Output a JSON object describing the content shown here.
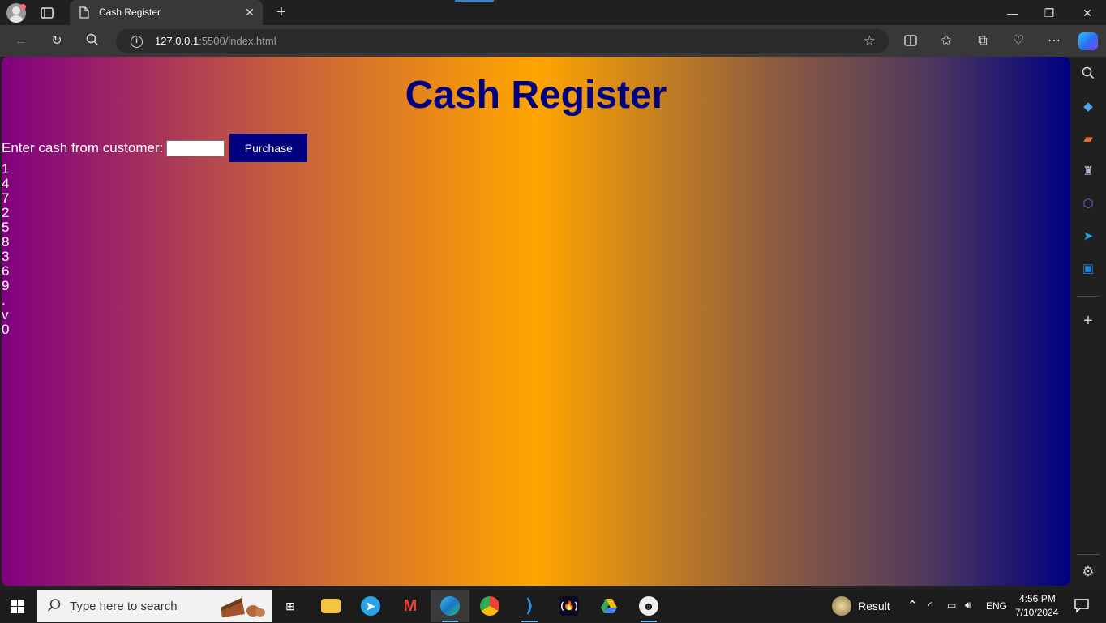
{
  "browser": {
    "tab": {
      "title": "Cash Register"
    },
    "address": {
      "host": "127.0.0.1",
      "path": ":5500/index.html"
    }
  },
  "page": {
    "title": "Cash Register",
    "cash_label": "Enter cash from customer:",
    "cash_input_value": "",
    "purchase_button": "Purchase",
    "keys": [
      "1",
      "4",
      "7",
      "2",
      "5",
      "8",
      "3",
      "6",
      "9",
      ".",
      "v",
      "0"
    ]
  },
  "taskbar": {
    "search_placeholder": "Type here to search",
    "weather_label": "Result",
    "language": "ENG",
    "time": "4:56 PM",
    "date": "7/10/2024"
  },
  "colors": {
    "title": "#000080",
    "button": "#000080",
    "gradient": [
      "#800080",
      "#ffa500",
      "#000080"
    ]
  }
}
